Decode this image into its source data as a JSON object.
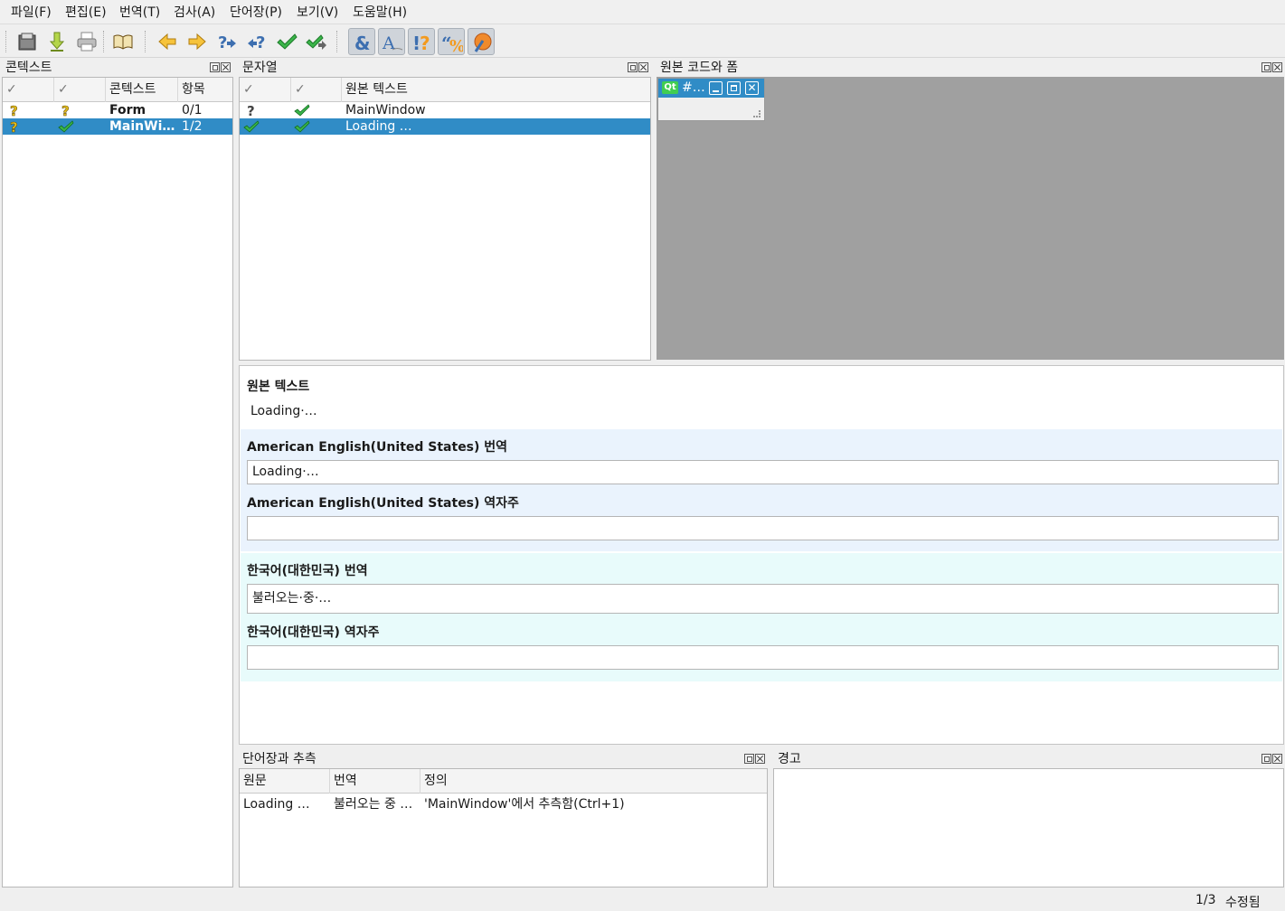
{
  "menu": [
    "파일(F)",
    "편집(E)",
    "번역(T)",
    "검사(A)",
    "단어장(P)",
    "보기(V)",
    "도움말(H)"
  ],
  "toolbar_icons": [
    "open-icon",
    "save-icon",
    "print-icon",
    "phrasebook-icon",
    "prev-icon",
    "next-icon",
    "prev-unfinished-icon",
    "next-unfinished-icon",
    "done-icon",
    "done-next-icon",
    "accelerator-check-icon",
    "punctuation-check-icon",
    "phrase-check-icon",
    "place-marker-check-icon",
    "surrounding-whitespace-check-icon"
  ],
  "context_dock": {
    "title": "콘텍스트",
    "headers": [
      "",
      "",
      "콘텍스트",
      "항목"
    ],
    "rows": [
      {
        "name": "Form",
        "count": "0/1",
        "selected": false
      },
      {
        "name": "MainWi…",
        "count": "1/2",
        "selected": true
      }
    ]
  },
  "strings_dock": {
    "title": "문자열",
    "headers": [
      "",
      "",
      "원본 텍스트"
    ],
    "rows": [
      {
        "text": "MainWindow",
        "selected": false
      },
      {
        "text": "Loading …",
        "selected": true
      }
    ]
  },
  "sources_dock": {
    "title": "원본 코드와 폼",
    "subwindow_title": "#…",
    "qt_label": "Qt"
  },
  "editor": {
    "source_label": "원본 텍스트",
    "source_text": "Loading·…",
    "lang1_translation_label": "American English(United States) 번역",
    "lang1_translation": "Loading·…",
    "lang1_comment_label": "American English(United States) 역자주",
    "lang1_comment": "",
    "lang2_translation_label": "한국어(대한민국) 번역",
    "lang2_translation": "불러오는·중·…",
    "lang2_comment_label": "한국어(대한민국) 역자주",
    "lang2_comment": ""
  },
  "phrases_dock": {
    "title": "단어장과 추측",
    "headers": [
      "원문",
      "번역",
      "정의"
    ],
    "rows": [
      {
        "source": "Loading …",
        "translation": "불러오는 중 …",
        "definition": "'MainWindow'에서 추측함(Ctrl+1)"
      }
    ]
  },
  "warnings_dock": {
    "title": "경고"
  },
  "status": {
    "progress": "1/3",
    "modified": "수정됨"
  },
  "colors": {
    "selection": "#308cc6",
    "band_blue": "#eaf3fd",
    "band_cyan": "#e8fbfb"
  }
}
